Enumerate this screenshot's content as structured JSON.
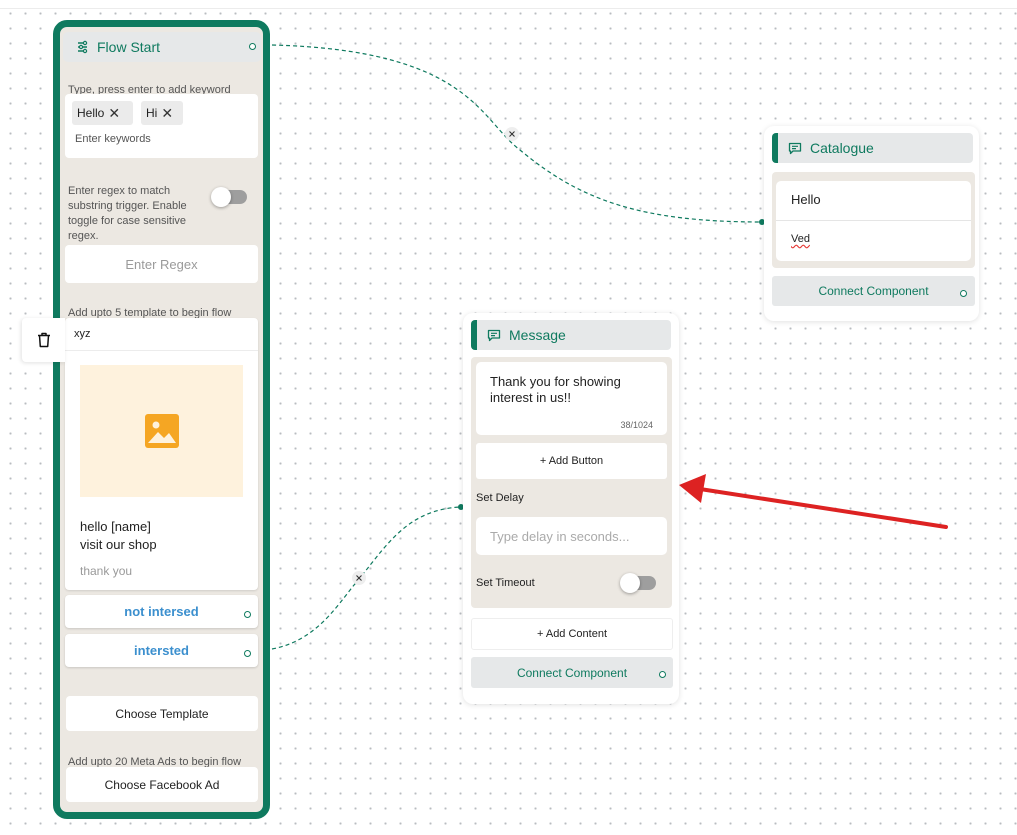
{
  "flow_start": {
    "title": "Flow Start",
    "keyword_hint": "Type, press enter to add keyword",
    "keywords": [
      "Hello",
      "Hi"
    ],
    "keyword_placeholder": "Enter keywords",
    "regex_hint": "Enter regex to match substring trigger. Enable toggle for case sensitive regex.",
    "regex_toggle_on": false,
    "regex_placeholder": "Enter Regex",
    "template_hint": "Add upto 5 template to begin flow",
    "template": {
      "name": "xyz",
      "body_line1": "hello [name]",
      "body_line2": "visit our shop",
      "footer": "thank you",
      "buttons": [
        "not intersed",
        "intersted"
      ]
    },
    "choose_template_label": "Choose Template",
    "ads_hint": "Add upto 20 Meta Ads to begin flow",
    "choose_ad_label": "Choose Facebook Ad"
  },
  "catalogue": {
    "title": "Catalogue",
    "items": [
      "Hello",
      "Ved"
    ],
    "connect_label": "Connect Component"
  },
  "message": {
    "title": "Message",
    "text": "Thank you for showing interest in us!!",
    "char_count": "38/1024",
    "add_button_label": "+ Add Button",
    "set_delay_label": "Set Delay",
    "delay_placeholder": "Type delay in seconds...",
    "set_timeout_label": "Set Timeout",
    "timeout_toggle_on": false,
    "add_content_label": "+ Add Content",
    "connect_label": "Connect Component"
  },
  "colors": {
    "brand": "#0f7a5f",
    "quick_reply": "#3b8fce",
    "annotation_arrow": "#dd2222",
    "template_image_bg": "#fef2dd",
    "image_icon": "#f5a623"
  },
  "icons": {
    "flow_start": "flow-icon",
    "node": "message-square-icon",
    "delete": "trash-icon",
    "edge_delete": "close-icon",
    "template_image": "image-placeholder-icon"
  }
}
